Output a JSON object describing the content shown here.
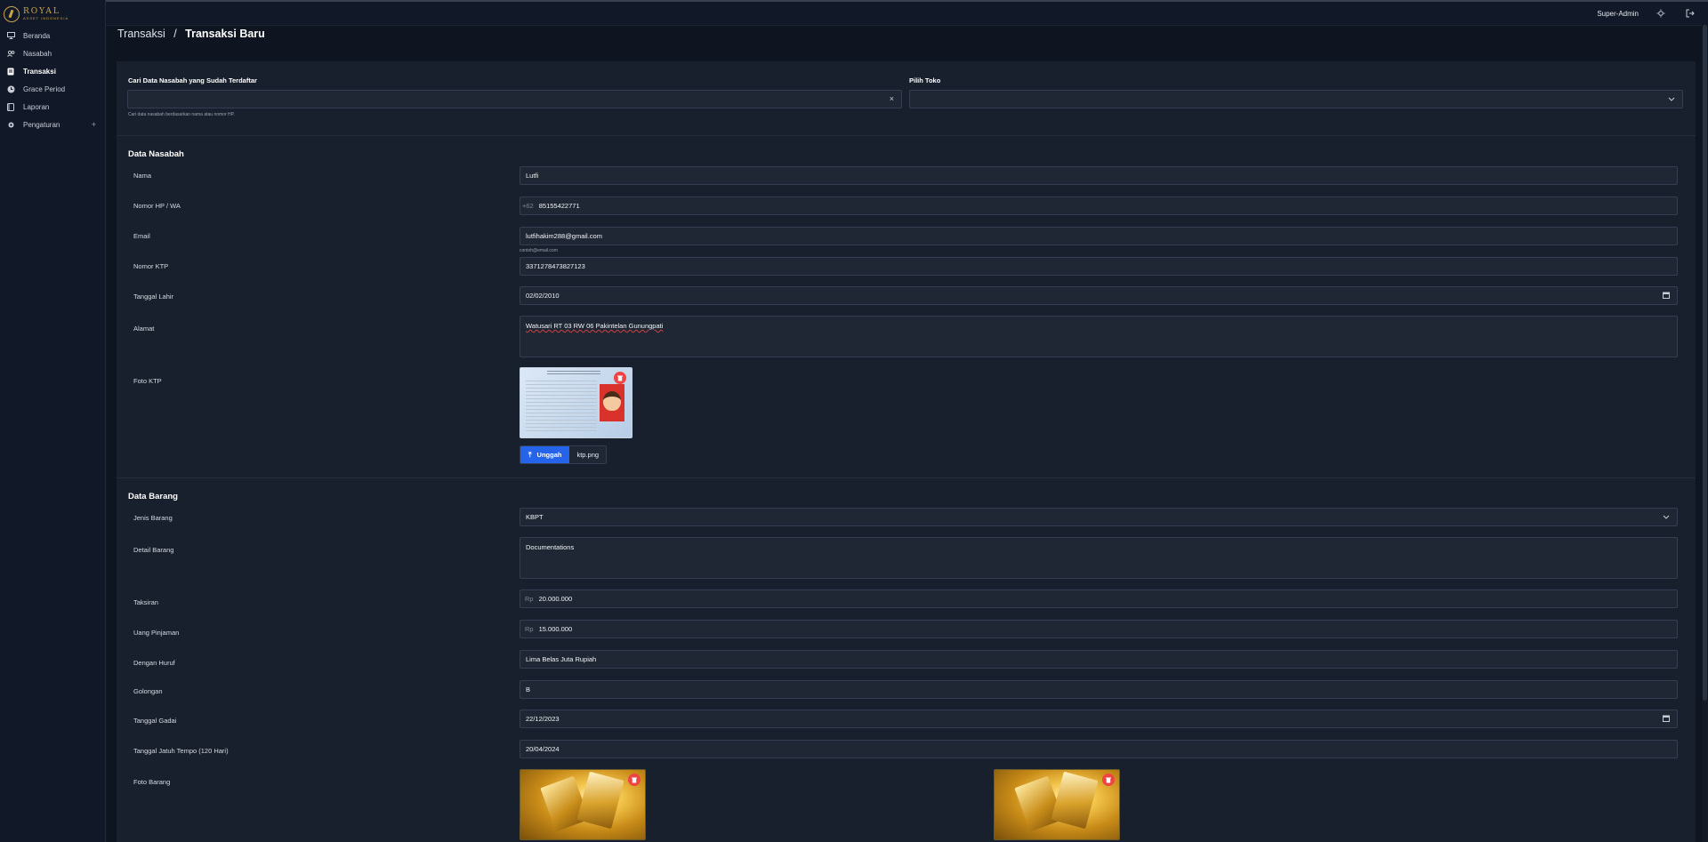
{
  "brand": {
    "name": "ROYAL",
    "sub": "ASSET INDONESIA"
  },
  "sidebar": {
    "items": [
      {
        "label": "Beranda",
        "icon": "monitor-icon"
      },
      {
        "label": "Nasabah",
        "icon": "users-icon"
      },
      {
        "label": "Transaksi",
        "icon": "document-icon",
        "active": true
      },
      {
        "label": "Grace Period",
        "icon": "clock-icon"
      },
      {
        "label": "Laporan",
        "icon": "book-icon"
      },
      {
        "label": "Pengaturan",
        "icon": "gear-icon"
      }
    ]
  },
  "header": {
    "user": "Super-Admin"
  },
  "breadcrumb": {
    "parent": "Transaksi",
    "separator": "/",
    "current": "Transaksi Baru"
  },
  "search": {
    "label": "Cari Data Nasabah yang Sudah Terdaftar",
    "value": "",
    "clear_symbol": "×",
    "hint": "Cari data nasabah berdasarkan nama atau nomor HP."
  },
  "store": {
    "label": "Pilih Toko",
    "value": ""
  },
  "nasabah": {
    "title": "Data Nasabah",
    "nama_label": "Nama",
    "nama": "Lutfi",
    "hp_label": "Nomor HP / WA",
    "hp_prefix": "+62",
    "hp": "85155422771",
    "email_label": "Email",
    "email": "lutfihakim288@gmail.com",
    "email_hint": "contoh@email.com",
    "ktp_label": "Nomor KTP",
    "ktp": "3371278473827123",
    "lahir_label": "Tanggal Lahir",
    "lahir": "02/02/2010",
    "alamat_label": "Alamat",
    "alamat": "Watusari RT 03 RW 06 Pakintelan Gunungpati",
    "foto_label": "Foto KTP",
    "upload_label": "Unggah",
    "upload_file": "ktp.png"
  },
  "barang": {
    "title": "Data Barang",
    "jenis_label": "Jenis Barang",
    "jenis": "KBPT",
    "detail_label": "Detail Barang",
    "detail": "Documentations",
    "taksiran_label": "Taksiran",
    "currency": "Rp",
    "taksiran": "20.000.000",
    "pinjaman_label": "Uang Pinjaman",
    "pinjaman": "15.000.000",
    "huruf_label": "Dengan Huruf",
    "huruf": "Lima Belas Juta Rupiah",
    "golongan_label": "Golongan",
    "golongan": "B",
    "gadai_label": "Tanggal Gadai",
    "gadai": "22/12/2023",
    "tempo_label": "Tanggal Jatuh Tempo (120 Hari)",
    "tempo": "20/04/2024",
    "foto_label": "Foto Barang"
  }
}
